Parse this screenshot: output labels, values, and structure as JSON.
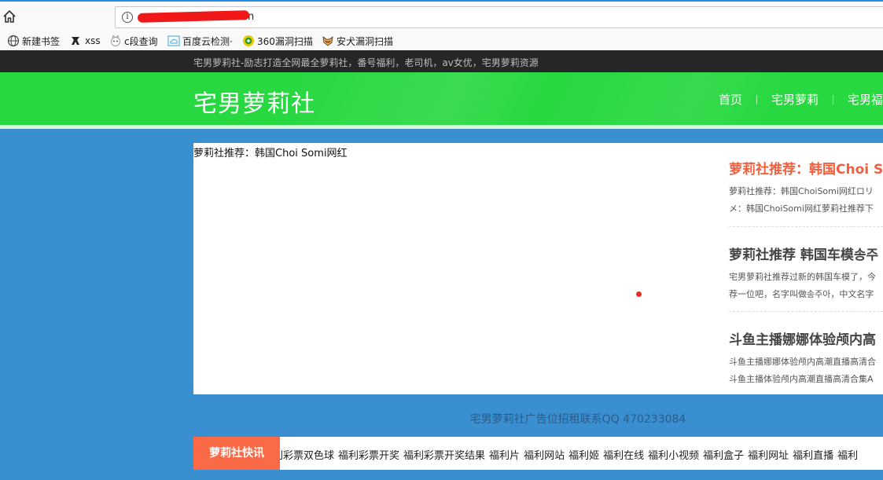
{
  "browser": {
    "url_visible_suffix": "n",
    "bookmarks": [
      {
        "label": "新建书签",
        "icon": "globe-icon"
      },
      {
        "label": "xss",
        "icon": "xss-bookmark-icon"
      },
      {
        "label": "c段查询",
        "icon": "c-query-icon"
      },
      {
        "label": "百度云检测·",
        "icon": "cloud-icon"
      },
      {
        "label": "360漏洞扫描",
        "icon": "360-icon"
      },
      {
        "label": "安犬漏洞扫描",
        "icon": "dog-icon"
      }
    ],
    "colors": {
      "url_redaction": "#f01818",
      "tab_accent": "#2a8ae8"
    }
  },
  "site": {
    "slogan": "宅男萝莉社-励志打造全网最全萝莉社，番号福利，老司机，av女优，宅男萝莉资源",
    "logo": "宅男萝莉社",
    "nav": [
      "首页",
      "宅男萝莉",
      "宅男福"
    ],
    "colors": {
      "header": "#27d840",
      "body": "#3a8fd0",
      "topbar": "#262626",
      "accent": "#fb6a47"
    }
  },
  "slider": {
    "caption": "萝莉社推荐：韩国Choi Somi网红"
  },
  "posts": [
    {
      "title": "萝莉社推荐：韩国Choi S",
      "title_color": "#f06040",
      "lines": [
        "萝莉社推荐：韩国ChoiSomi网红ロリ",
        "メ：韩国ChoiSomi网红萝莉社推荐下"
      ]
    },
    {
      "title": "萝莉社推荐 韩国车模송주",
      "title_color": "#444444",
      "lines": [
        "宅男萝莉社推荐过新的韩国车模了，今",
        "荐一位吧，名字叫做송주아，中文名字"
      ]
    },
    {
      "title": "斗鱼主播娜娜体验颅内高",
      "title_color": "#444444",
      "lines": [
        "斗鱼主播娜娜体验颅内高潮直播高清合",
        "斗鱼主播体验颅内高潮直播高清合集A"
      ]
    }
  ],
  "ad": {
    "text": "宅男萝莉社广告位招租联系QQ 470233084"
  },
  "news": {
    "label": "萝莉社快讯",
    "items": [
      "利彩票双色球",
      "福利彩票开奖",
      "福利彩票开奖结果",
      "福利片",
      "福利网站",
      "福利姬",
      "福利在线",
      "福利小视频",
      "福利盒子",
      "福利网址",
      "福利直播",
      "福利"
    ]
  }
}
